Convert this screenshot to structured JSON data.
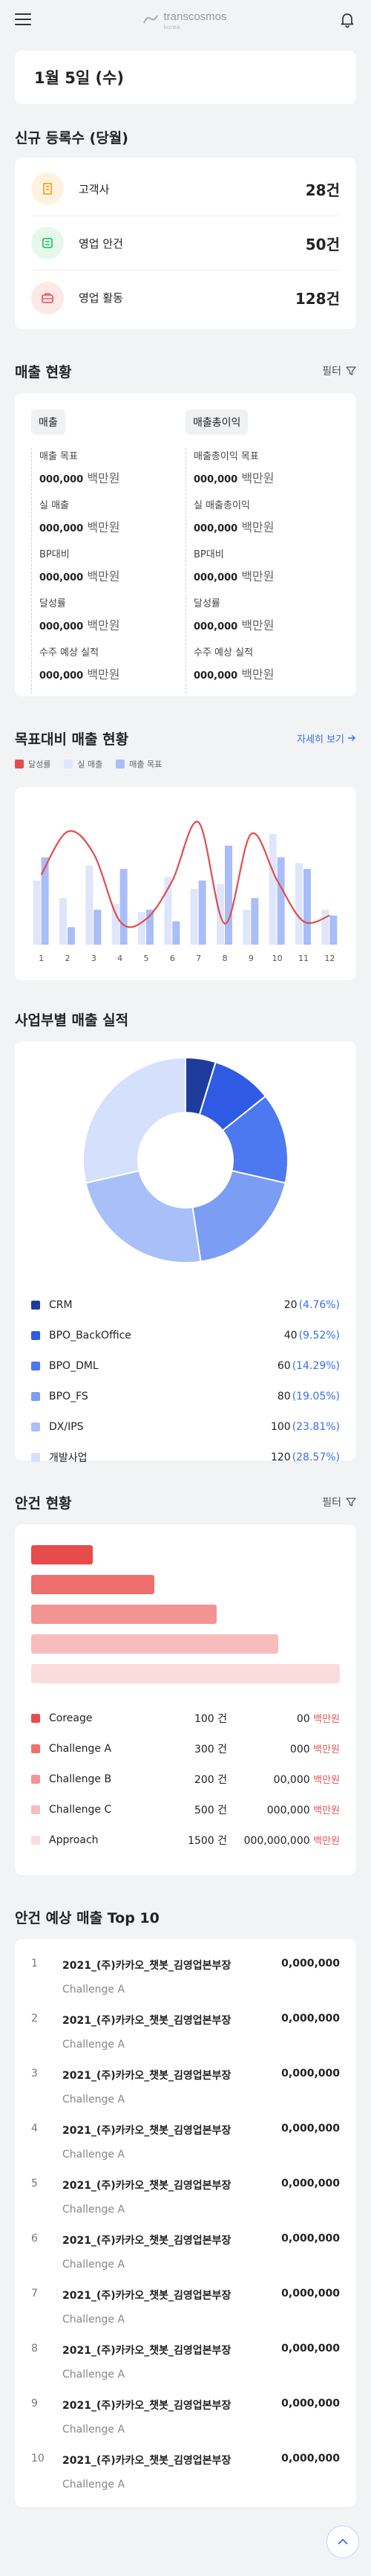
{
  "header": {
    "logo_text": "transcosmos",
    "logo_sub": "korea"
  },
  "date": "1월 5일 (수)",
  "new_reg": {
    "title": "신규 등록수 (당월)",
    "items": [
      {
        "label": "고객사",
        "value": "28건",
        "icon": "building-icon",
        "bg": "#fff3e0",
        "color": "#f5a623"
      },
      {
        "label": "영업 안건",
        "value": "50건",
        "icon": "document-icon",
        "bg": "#e6f8ec",
        "color": "#2ec66b"
      },
      {
        "label": "영업 활동",
        "value": "128건",
        "icon": "briefcase-icon",
        "bg": "#fde8e8",
        "color": "#e86060"
      }
    ]
  },
  "sales": {
    "title": "매출 현황",
    "filter_label": "필터",
    "col1": {
      "tag": "매출",
      "items": [
        {
          "label": "매출 목표",
          "value": "000,000",
          "unit": "백만원"
        },
        {
          "label": "실 매출",
          "value": "000,000",
          "unit": "백만원"
        },
        {
          "label": "BP대비",
          "value": "000,000",
          "unit": "백만원"
        },
        {
          "label": "달성률",
          "value": "000,000",
          "unit": "백만원"
        },
        {
          "label": "수주 예상 실적",
          "value": "000,000",
          "unit": "백만원"
        }
      ]
    },
    "col2": {
      "tag": "매출총이익",
      "items": [
        {
          "label": "매출총이익 목표",
          "value": "000,000",
          "unit": "백만원"
        },
        {
          "label": "실 매출총이익",
          "value": "000,000",
          "unit": "백만원"
        },
        {
          "label": "BP대비",
          "value": "000,000",
          "unit": "백만원"
        },
        {
          "label": "달성률",
          "value": "000,000",
          "unit": "백만원"
        },
        {
          "label": "수주 예상 실적",
          "value": "000,000",
          "unit": "백만원"
        }
      ]
    }
  },
  "target_chart": {
    "title": "목표대비 매출 현황",
    "more_label": "자세히 보기",
    "legend": [
      {
        "label": "달성률",
        "color": "#e44c4c"
      },
      {
        "label": "실 매출",
        "color": "#dfe6fb"
      },
      {
        "label": "매출 목표",
        "color": "#a9bdf8"
      }
    ]
  },
  "chart_data": {
    "type": "bar",
    "categories": [
      "1",
      "2",
      "3",
      "4",
      "5",
      "6",
      "7",
      "8",
      "9",
      "10",
      "11",
      "12"
    ],
    "series": [
      {
        "name": "실 매출",
        "values": [
          55,
          40,
          68,
          35,
          28,
          58,
          48,
          52,
          30,
          95,
          70,
          30
        ],
        "color": "#dfe6fb"
      },
      {
        "name": "매출 목표",
        "values": [
          75,
          15,
          30,
          65,
          30,
          20,
          55,
          85,
          40,
          75,
          65,
          25
        ],
        "color": "#a9bdf8"
      },
      {
        "name": "달성률",
        "type": "line",
        "values": [
          60,
          97,
          78,
          20,
          22,
          55,
          105,
          18,
          95,
          55,
          20,
          25
        ],
        "color": "#e44c4c"
      }
    ],
    "ylim": [
      0,
      120
    ]
  },
  "biz_chart": {
    "title": "사업부별 매출 실적",
    "items": [
      {
        "name": "CRM",
        "value": "20",
        "pct": "(4.76%)",
        "num": 20,
        "color": "#1f3c9c"
      },
      {
        "name": "BPO_BackOffice",
        "value": "40",
        "pct": "(9.52%)",
        "num": 40,
        "color": "#2f5be4"
      },
      {
        "name": "BPO_DML",
        "value": "60",
        "pct": "(14.29%)",
        "num": 60,
        "color": "#4c78f0"
      },
      {
        "name": "BPO_FS",
        "value": "80",
        "pct": "(19.05%)",
        "num": 80,
        "color": "#7c9df4"
      },
      {
        "name": "DX/IPS",
        "value": "100",
        "pct": "(23.81%)",
        "num": 100,
        "color": "#a8bff8"
      },
      {
        "name": "개발사업",
        "value": "120",
        "pct": "(28.57%)",
        "num": 120,
        "color": "#d4e0fc"
      }
    ]
  },
  "deals": {
    "title": "안건 현황",
    "filter_label": "필터",
    "items": [
      {
        "name": "Coreage",
        "count": "100 건",
        "amt": "00",
        "unit": "백만원",
        "color": "#e84b4b",
        "ratio": 0.2
      },
      {
        "name": "Challenge A",
        "count": "300 건",
        "amt": "000",
        "unit": "백만원",
        "color": "#ef6f6f",
        "ratio": 0.4
      },
      {
        "name": "Challenge B",
        "count": "200 건",
        "amt": "00,000",
        "unit": "백만원",
        "color": "#f39494",
        "ratio": 0.6
      },
      {
        "name": "Challenge C",
        "count": "500 건",
        "amt": "000,000",
        "unit": "백만원",
        "color": "#f8bcbc",
        "ratio": 0.8
      },
      {
        "name": "Approach",
        "count": "1500 건",
        "amt": "000,000,000",
        "unit": "백만원",
        "color": "#fbdcdc",
        "ratio": 1.0
      }
    ]
  },
  "top10": {
    "title": "안건 예상 매출 Top 10",
    "items": [
      {
        "rank": "1",
        "title": "2021_(주)카카오_챗봇_김영업본부장",
        "sub": "Challenge A",
        "amt": "0,000,000"
      },
      {
        "rank": "2",
        "title": "2021_(주)카카오_챗봇_김영업본부장",
        "sub": "Challenge A",
        "amt": "0,000,000"
      },
      {
        "rank": "3",
        "title": "2021_(주)카카오_챗봇_김영업본부장",
        "sub": "Challenge A",
        "amt": "0,000,000"
      },
      {
        "rank": "4",
        "title": "2021_(주)카카오_챗봇_김영업본부장",
        "sub": "Challenge A",
        "amt": "0,000,000"
      },
      {
        "rank": "5",
        "title": "2021_(주)카카오_챗봇_김영업본부장",
        "sub": "Challenge A",
        "amt": "0,000,000"
      },
      {
        "rank": "6",
        "title": "2021_(주)카카오_챗봇_김영업본부장",
        "sub": "Challenge A",
        "amt": "0,000,000"
      },
      {
        "rank": "7",
        "title": "2021_(주)카카오_챗봇_김영업본부장",
        "sub": "Challenge A",
        "amt": "0,000,000"
      },
      {
        "rank": "8",
        "title": "2021_(주)카카오_챗봇_김영업본부장",
        "sub": "Challenge A",
        "amt": "0,000,000"
      },
      {
        "rank": "9",
        "title": "2021_(주)카카오_챗봇_김영업본부장",
        "sub": "Challenge A",
        "amt": "0,000,000"
      },
      {
        "rank": "10",
        "title": "2021_(주)카카오_챗봇_김영업본부장",
        "sub": "Challenge A",
        "amt": "0,000,000"
      }
    ]
  }
}
